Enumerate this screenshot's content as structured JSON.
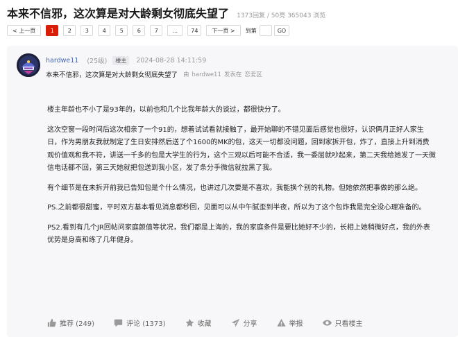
{
  "thread": {
    "title": "本来不信邪，这次算是对大龄剩女彻底失望了",
    "stats": "1373回复 / 50亮 365043 浏览"
  },
  "pagination": {
    "prev": "< 上一页",
    "pages": [
      "1",
      "2",
      "3",
      "4",
      "5",
      "6",
      "7"
    ],
    "current_page": "1",
    "ellipsis": "...",
    "last": "74",
    "next": "下一页 >",
    "goto_label": "到第",
    "go": "GO"
  },
  "post": {
    "avatar_icon": "avatar-image",
    "author": "hardwe11",
    "level": "(25级)",
    "op_badge": "楼主",
    "time": "2024-08-28 14:11:59",
    "title": "本来不信邪，这次算是对大龄剩女彻底失望了",
    "publish_note": {
      "prefix": "由",
      "author": "hardwe11",
      "verb": "发表在",
      "board": "恋爱区"
    },
    "paragraphs": [
      "楼主年龄也不小了是93年的，以前也和几个比我年龄大的谈过，都很快分了。",
      "这次空窗一段时间后这次相亲了一个91的，想着试试看就接触了，最开始聊的不错见面后感觉也很好，认识俩月正好人家生日，作为男朋友我就制定了生日安排然后送了个1600的MK的包，这天一切都没问题，回到家拆开包，炸了，直接上升到消费观价值观和我不符，讲送一千多的包是大学生的行为，这个三观以后可能不合适，我一委屈就吵起来，第二天我给她发了一天微信电话都不回，第三天她就把包送到我小区，发了条分手微信就拉黑了我。",
      "有个细节是在未拆开前我已告知包是个什么情况，也讲过几次要是不喜欢，我能换个别的礼物。但她依然把事做的那么绝。",
      "PS.之前都很甜蜜，平时双方基本看见消息都秒回，见面可以从中午腻歪到半夜，所以为了这个包炸我是完全没心理准备的。",
      "PS2.看到有几个JR回帖问家庭颜值等状况，我们都是上海的，我的家庭条件是要比她好不少的，长相上她稍微好点，我的外表优势是身高和练了几年健身。"
    ],
    "actions": {
      "recommend": "推荐 (249)",
      "comment": "评论 (1373)",
      "favorite": "收藏",
      "share": "分享",
      "report": "举报",
      "only_op": "只看楼主"
    }
  }
}
